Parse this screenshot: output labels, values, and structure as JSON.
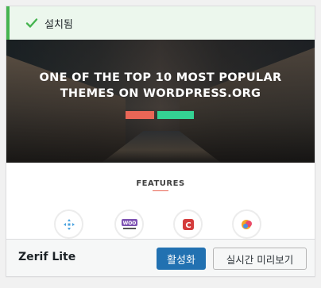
{
  "notice": {
    "text": "설치됨",
    "icon": "checkmark-icon",
    "accent_color": "#46b450"
  },
  "screenshot": {
    "hero_title_line1": "ONE OF THE TOP 10 MOST POPULAR",
    "hero_title_line2": "THEMES ON WORDPRESS.ORG",
    "features_title": "FEATURES",
    "feature_icons": [
      "customizer-icon",
      "woocommerce-icon",
      "c-logo-icon",
      "chat-bubble-icon"
    ]
  },
  "footer": {
    "theme_name": "Zerif Lite",
    "activate_label": "활성화",
    "preview_label": "실시간 미리보기",
    "primary_color": "#2271b1"
  }
}
